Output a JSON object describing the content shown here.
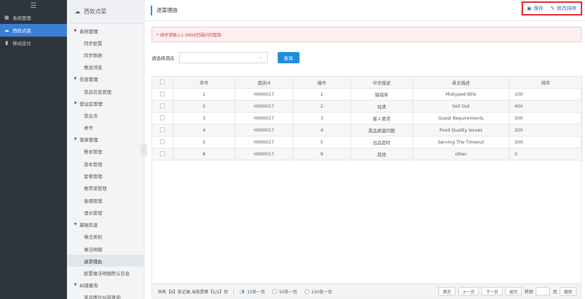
{
  "sidebar": {
    "toggle_icon": "hamburger-icon",
    "items": [
      {
        "label": "系统管理",
        "icon": "grid-icon",
        "glyph": "▦",
        "active": false
      },
      {
        "label": "西软点菜",
        "icon": "cloud-icon",
        "glyph": "☁",
        "active": true
      },
      {
        "label": "移动支付",
        "icon": "mobile-icon",
        "glyph": "▮",
        "active": false
      }
    ]
  },
  "menu": {
    "header": "西软点菜",
    "entries": [
      {
        "type": "group",
        "label": "系统管理"
      },
      {
        "type": "item",
        "label": "同步配置"
      },
      {
        "type": "item",
        "label": "同步数据"
      },
      {
        "type": "item",
        "label": "推送消息"
      },
      {
        "type": "group",
        "label": "信息管理"
      },
      {
        "type": "item",
        "label": "菜品信息管理"
      },
      {
        "type": "group",
        "label": "营业区管理"
      },
      {
        "type": "item",
        "label": "营业点"
      },
      {
        "type": "item",
        "label": "桌号"
      },
      {
        "type": "group",
        "label": "菜单管理"
      },
      {
        "type": "item",
        "label": "餐本管理"
      },
      {
        "type": "item",
        "label": "菜本管理"
      },
      {
        "type": "item",
        "label": "套餐管理"
      },
      {
        "type": "item",
        "label": "推荐菜管理"
      },
      {
        "type": "item",
        "label": "香烟管理"
      },
      {
        "type": "item",
        "label": "酒水管理"
      },
      {
        "type": "group",
        "label": "基础信息"
      },
      {
        "type": "item",
        "label": "做法类别"
      },
      {
        "type": "item",
        "label": "做法明细"
      },
      {
        "type": "item",
        "label": "退菜理由",
        "active": true
      },
      {
        "type": "item",
        "label": "配置做法明细默认信息"
      },
      {
        "type": "group",
        "label": "纠错查询"
      },
      {
        "type": "item",
        "label": "菜品图片纠错查询"
      }
    ]
  },
  "page": {
    "title": "退菜理由",
    "save_label": "保存",
    "sort_label": "修改排序",
    "tip": "* 排序请输入1-9999范围内的整数",
    "filter_label": "请选择酒店",
    "query_label": "查询"
  },
  "table": {
    "headers": [
      "序号",
      "酒店id",
      "编号",
      "中文描述",
      "英文描述",
      "排序"
    ],
    "rows": [
      [
        "1",
        "H000017",
        "1",
        "输错单",
        "Mistyped Bills",
        "100"
      ],
      [
        "2",
        "H000017",
        "2",
        "估清",
        "Sell Out",
        "400"
      ],
      [
        "3",
        "H000017",
        "3",
        "客人要求",
        "Guest Requirements",
        "500"
      ],
      [
        "4",
        "H000017",
        "4",
        "菜品质量问题",
        "Food Quality Issues",
        "200"
      ],
      [
        "5",
        "H000017",
        "5",
        "出品超时",
        "Serving The Timeout",
        "300"
      ],
      [
        "6",
        "H000017",
        "9",
        "其他",
        "other",
        "0"
      ]
    ]
  },
  "pager": {
    "summary": "共有【6】条记录,当前是第【1/1】页",
    "size_options": [
      {
        "label": "15条一页",
        "selected": true
      },
      {
        "label": "50条一页",
        "selected": false
      },
      {
        "label": "100条一页",
        "selected": false
      }
    ],
    "first": "首页",
    "prev": "上一页",
    "next": "下一页",
    "last": "尾页",
    "goto_label": "转到",
    "page_unit": "页",
    "jump": "跳转"
  }
}
